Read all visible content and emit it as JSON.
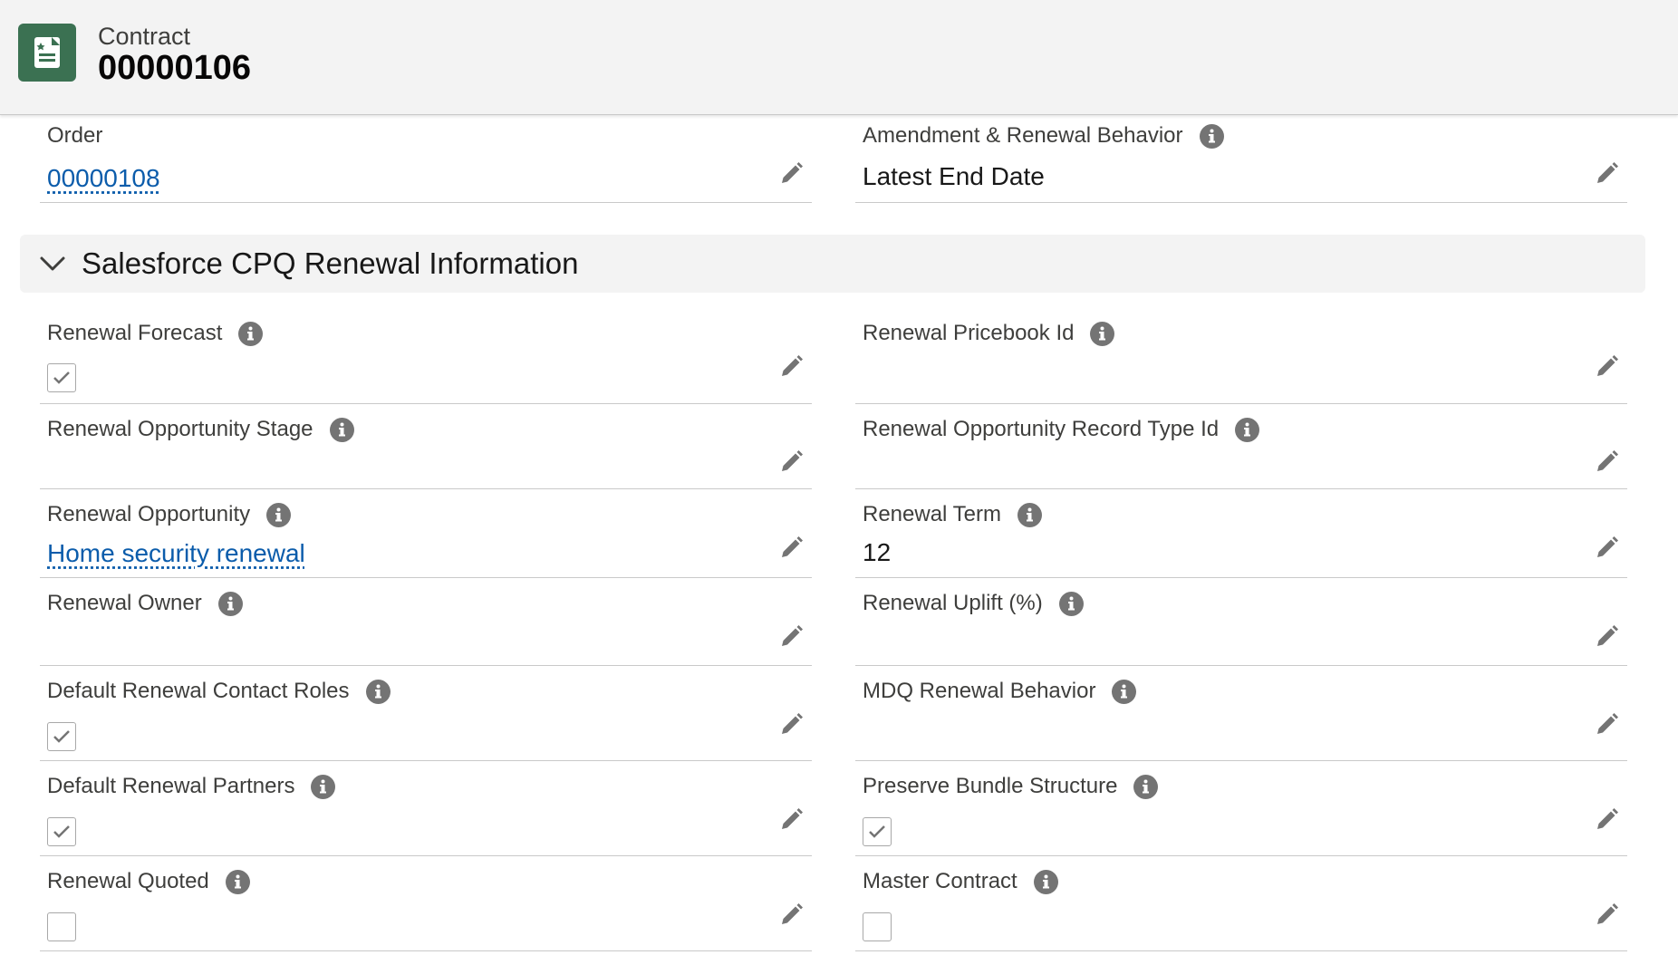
{
  "header": {
    "object_type": "Contract",
    "record_name": "00000106",
    "icon": "contract-icon",
    "icon_color": "#3b7152"
  },
  "top_fields": {
    "order": {
      "label": "Order",
      "value": "00000108"
    },
    "amendment": {
      "label": "Amendment & Renewal Behavior",
      "value": "Latest End Date"
    }
  },
  "section": {
    "title": "Salesforce CPQ Renewal Information",
    "expanded": true
  },
  "fields": {
    "renewal_forecast": {
      "label": "Renewal Forecast",
      "checked": true
    },
    "renewal_pricebook_id": {
      "label": "Renewal Pricebook Id",
      "value": ""
    },
    "renewal_opportunity_stage": {
      "label": "Renewal Opportunity Stage",
      "value": ""
    },
    "renewal_opportunity_record_type_id": {
      "label": "Renewal Opportunity Record Type Id",
      "value": ""
    },
    "renewal_opportunity": {
      "label": "Renewal Opportunity",
      "value": "Home security renewal"
    },
    "renewal_term": {
      "label": "Renewal Term",
      "value": "12"
    },
    "renewal_owner": {
      "label": "Renewal Owner",
      "value": ""
    },
    "renewal_uplift": {
      "label": "Renewal Uplift (%)",
      "value": ""
    },
    "default_renewal_contact_roles": {
      "label": "Default Renewal Contact Roles",
      "checked": true
    },
    "mdq_renewal_behavior": {
      "label": "MDQ Renewal Behavior",
      "value": ""
    },
    "default_renewal_partners": {
      "label": "Default Renewal Partners",
      "checked": true
    },
    "preserve_bundle_structure": {
      "label": "Preserve Bundle Structure",
      "checked": true
    },
    "renewal_quoted": {
      "label": "Renewal Quoted",
      "checked": false
    },
    "master_contract": {
      "label": "Master Contract",
      "checked": false
    }
  },
  "colors": {
    "link": "#0b5cab",
    "info_icon": "#747474",
    "edit_icon": "#747474",
    "header_bg": "#f3f3f3"
  }
}
